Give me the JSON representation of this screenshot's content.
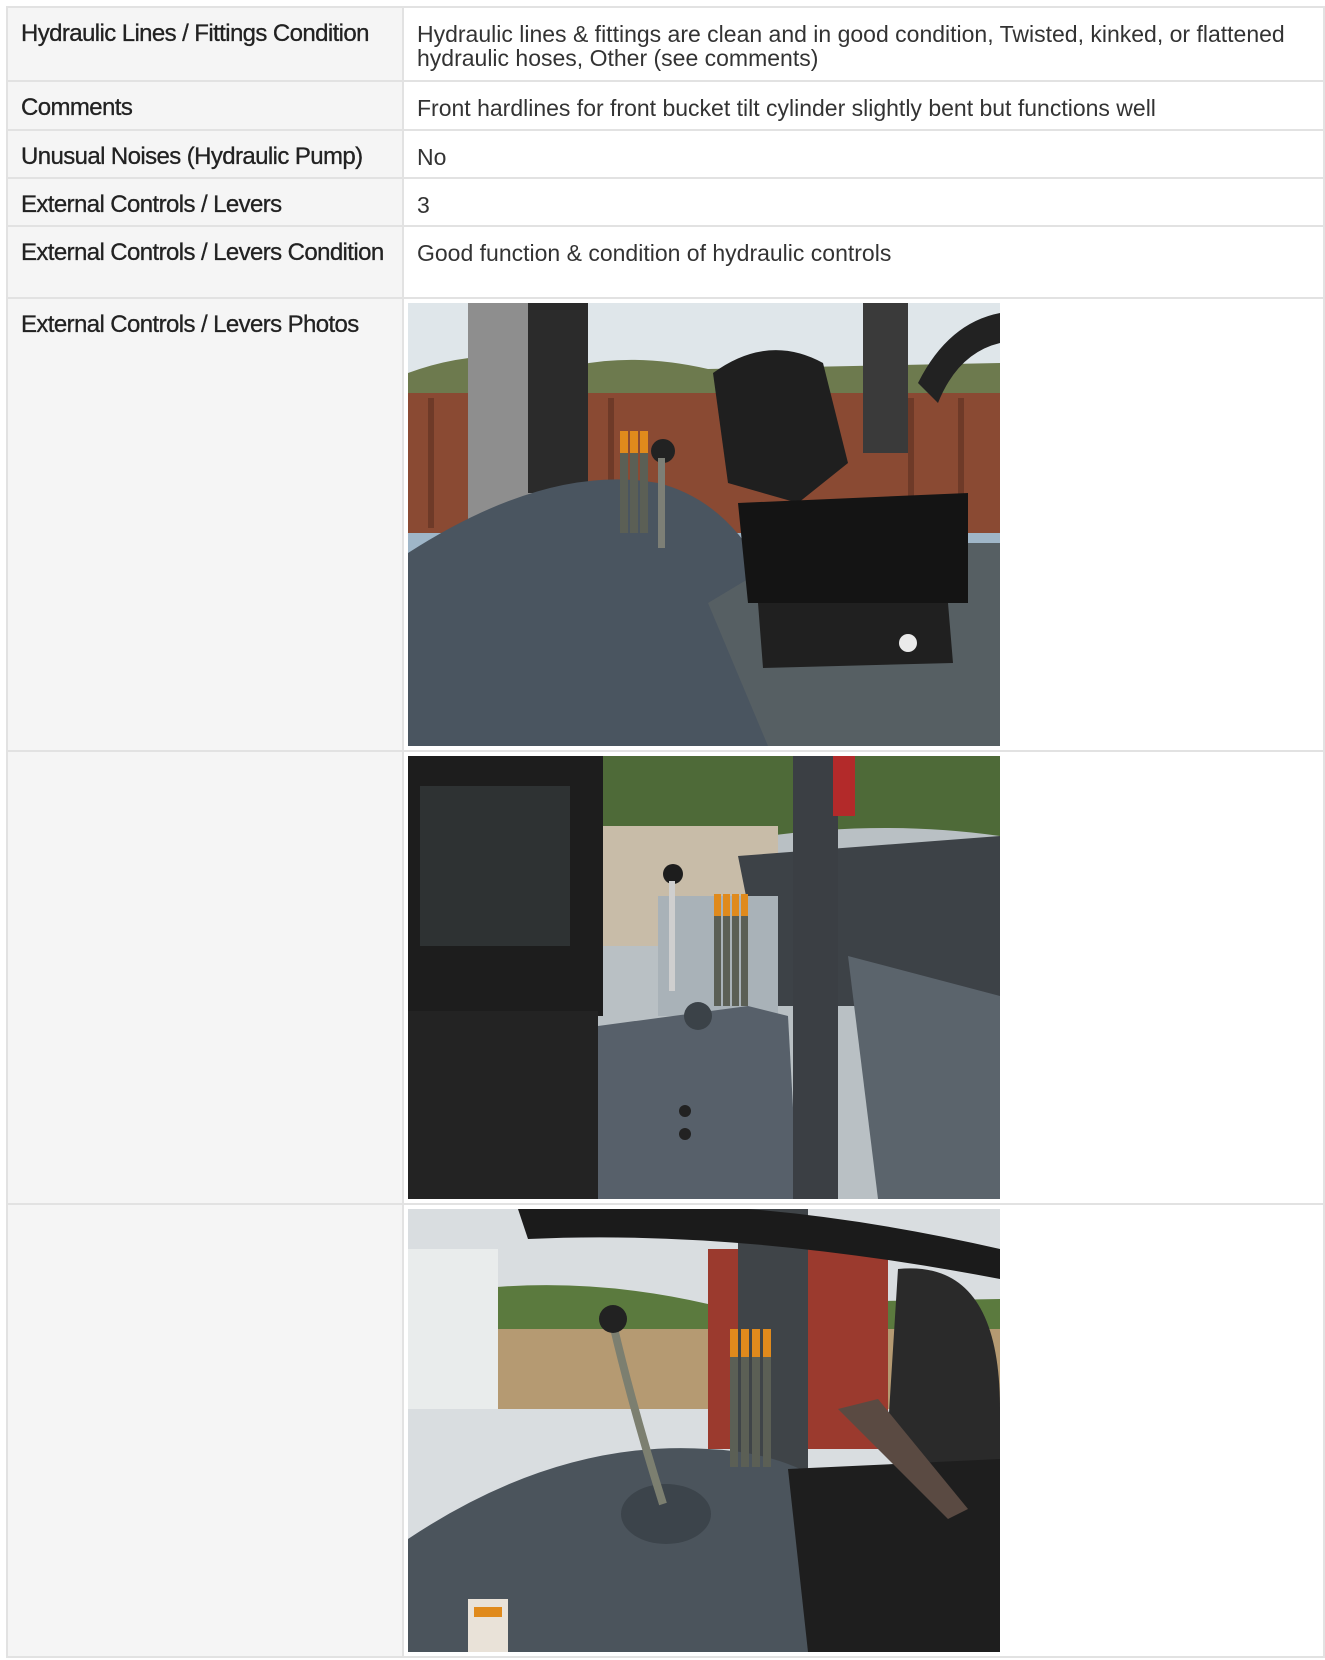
{
  "rows": [
    {
      "label": "Hydraulic Lines / Fittings Condition",
      "value": "Hydraulic lines & fittings are clean and in good condition, Twisted, kinked, or flattened hydraulic hoses, Other (see comments)"
    },
    {
      "label": "Comments",
      "value": "Front hardlines for front bucket tilt cylinder slightly bent but functions well"
    },
    {
      "label": "Unusual Noises (Hydraulic Pump)",
      "value": "No"
    },
    {
      "label": "External Controls / Levers",
      "value": "3"
    },
    {
      "label": "External Controls / Levers Condition",
      "value": "Good function & condition of hydraulic controls"
    },
    {
      "label": "External Controls / Levers Photos",
      "value": ""
    }
  ],
  "photos": [
    {
      "subject": "operator seat with hydraulic control levers (orange tipped) beside seat, rusted fence background"
    },
    {
      "subject": "rear view of seat, hydraulic levers and roll-cage post, pickup truck in background"
    },
    {
      "subject": "steering wheel above hydraulic control levers with orange tips and gear shifter"
    }
  ]
}
